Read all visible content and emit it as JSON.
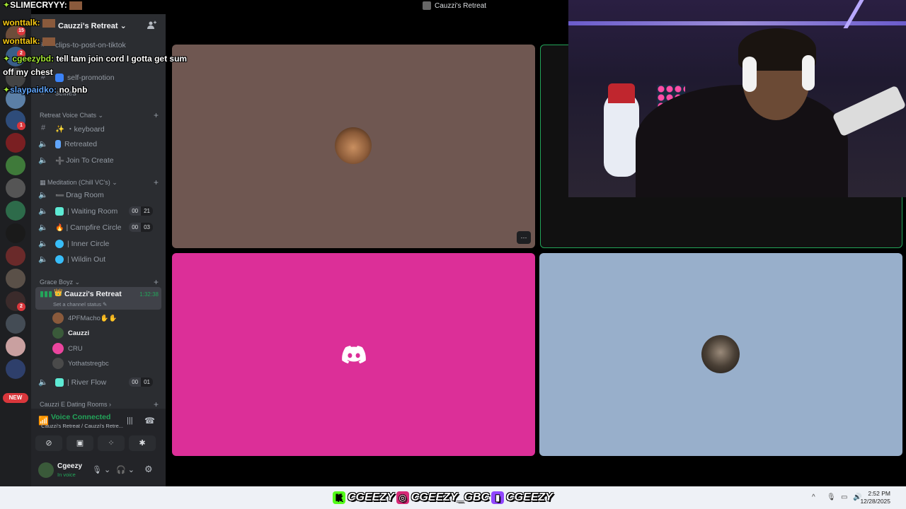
{
  "colors": {
    "discord_accent": "#5865f2",
    "voice_green": "#23a55a",
    "tile_brown": "#6f5751",
    "tile_pink": "#dc2f98",
    "tile_blue": "#98afcb"
  },
  "chat_overlay": {
    "streamer": "SLIMECRYYY:",
    "messages": [
      {
        "user": "wonttalk:",
        "text": ""
      },
      {
        "user": "wonttalk:",
        "text": ""
      },
      {
        "user": "cgeezybd:",
        "text": "tell tam join cord I gotta get sum"
      },
      {
        "user": "",
        "text": "off my chest"
      },
      {
        "user": "slaypaidko:",
        "text": "no bnb"
      }
    ]
  },
  "server": {
    "name": "Cauzzi's Retreat",
    "text_channels": [
      "clips-to-post-on-tiktok",
      "self-promotion",
      "selfies"
    ],
    "categories": [
      {
        "name": "Retreat Voice Chats",
        "channels": [
          {
            "label": "・keyboard",
            "type": "text",
            "emoji": "✨"
          },
          {
            "label": "Retreated",
            "type": "voice",
            "emoji": ""
          },
          {
            "label": "Join To Create",
            "type": "voice",
            "emoji": "➕"
          }
        ]
      },
      {
        "name": "Meditation (Chill VC's)",
        "channels": [
          {
            "label": "Drag Room",
            "type": "voice",
            "emoji": "➖",
            "counts": []
          },
          {
            "label": "| Waiting Room",
            "type": "voice",
            "emoji": "",
            "counts": [
              "00",
              "21"
            ]
          },
          {
            "label": "| Campfire Circle",
            "type": "voice",
            "emoji": "🔥",
            "counts": [
              "00",
              "03"
            ]
          },
          {
            "label": "| Inner Circle",
            "type": "voice",
            "emoji": "",
            "counts": []
          },
          {
            "label": "| Wildin Out",
            "type": "voice",
            "emoji": "",
            "counts": []
          }
        ]
      },
      {
        "name": "Grace Boyz",
        "channels": [
          {
            "label": "Cauzzi's Retreat",
            "type": "voice-active",
            "emoji": "👑",
            "timer": "1:32:38",
            "status": "Set a channel status"
          }
        ],
        "users": [
          "4PFMacho✋✋",
          "Cauzzi",
          "CRU",
          "Yothatstregbc"
        ],
        "after": [
          {
            "label": "| River Flow",
            "type": "voice",
            "counts": [
              "00",
              "01"
            ]
          }
        ]
      },
      {
        "name": "Cauzzi E Dating Rooms",
        "channels": []
      }
    ]
  },
  "rail": {
    "badges": [
      "15",
      "2",
      "1",
      "2"
    ],
    "new_label": "NEW"
  },
  "voice_panel": {
    "status": "Voice Connected",
    "location": "Cauzzi's Retreat / Cauzzi's Retre...",
    "user_name": "Cgeezy",
    "user_status": "In voice"
  },
  "call": {
    "title": "Cauzzi's Retreat",
    "more_label": "···"
  },
  "taskbar": {
    "handles": [
      "CGEEZY",
      "CGEEZY_GBC",
      "CGEEZY"
    ],
    "time": "2:52 PM",
    "date": "12/28/2025"
  },
  "icons": {
    "tile_more": "ellipsis-icon",
    "discord": "discord-logo-icon",
    "invite": "add-person-icon"
  }
}
